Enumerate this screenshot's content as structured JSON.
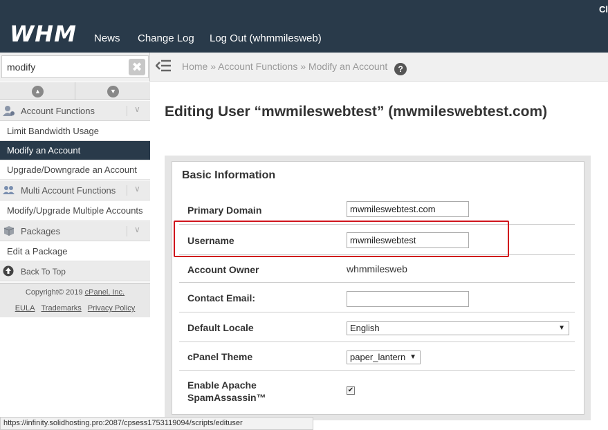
{
  "header": {
    "logo": "WHM",
    "nav": [
      "News",
      "Change Log",
      "Log Out (whmmilesweb)"
    ],
    "corner": "Cl"
  },
  "sidebar": {
    "search_value": "modify",
    "clear_glyph": "✖",
    "scroll_up_glyph": "▲",
    "scroll_down_glyph": "▼",
    "categories": [
      {
        "label": "Account Functions",
        "icon": "user-icon"
      },
      {
        "label": "Multi Account Functions",
        "icon": "users-icon"
      },
      {
        "label": "Packages",
        "icon": "package-icon"
      }
    ],
    "items": [
      {
        "label": "Limit Bandwidth Usage"
      },
      {
        "label": "Modify an Account",
        "active": true
      },
      {
        "label": "Upgrade/Downgrade an Account"
      },
      {
        "label": "Modify/Upgrade Multiple Accounts"
      },
      {
        "label": "Edit a Package"
      }
    ],
    "back_to_top": "Back To Top",
    "footer": {
      "copyright_prefix": "Copyright© 2019 ",
      "copyright_link": "cPanel, Inc.",
      "links": [
        "EULA",
        "Trademarks",
        "Privacy Policy"
      ]
    }
  },
  "breadcrumb": {
    "items": [
      "Home",
      "Account Functions",
      "Modify an Account"
    ],
    "separator": "»"
  },
  "main": {
    "title": "Editing User “mwmileswebtest” (mwmileswebtest.com)",
    "panel_title": "Basic Information",
    "fields": {
      "primary_domain": {
        "label": "Primary Domain",
        "value": "mwmileswebtest.com"
      },
      "username": {
        "label": "Username",
        "value": "mwmileswebtest"
      },
      "account_owner": {
        "label": "Account Owner",
        "value": "whmmilesweb"
      },
      "contact_email": {
        "label": "Contact Email:",
        "value": ""
      },
      "default_locale": {
        "label": "Default Locale",
        "value": "English"
      },
      "cpanel_theme": {
        "label": "cPanel Theme",
        "value": "paper_lantern"
      },
      "spamassassin": {
        "label_line1": "Enable Apache",
        "label_line2": "SpamAssassin™",
        "checked": true
      }
    }
  },
  "status_url": "https://infinity.solidhosting.pro:2087/cpsess1753119094/scripts/edituser",
  "colors": {
    "topbar": "#293a4a",
    "highlight": "#d0141c"
  }
}
